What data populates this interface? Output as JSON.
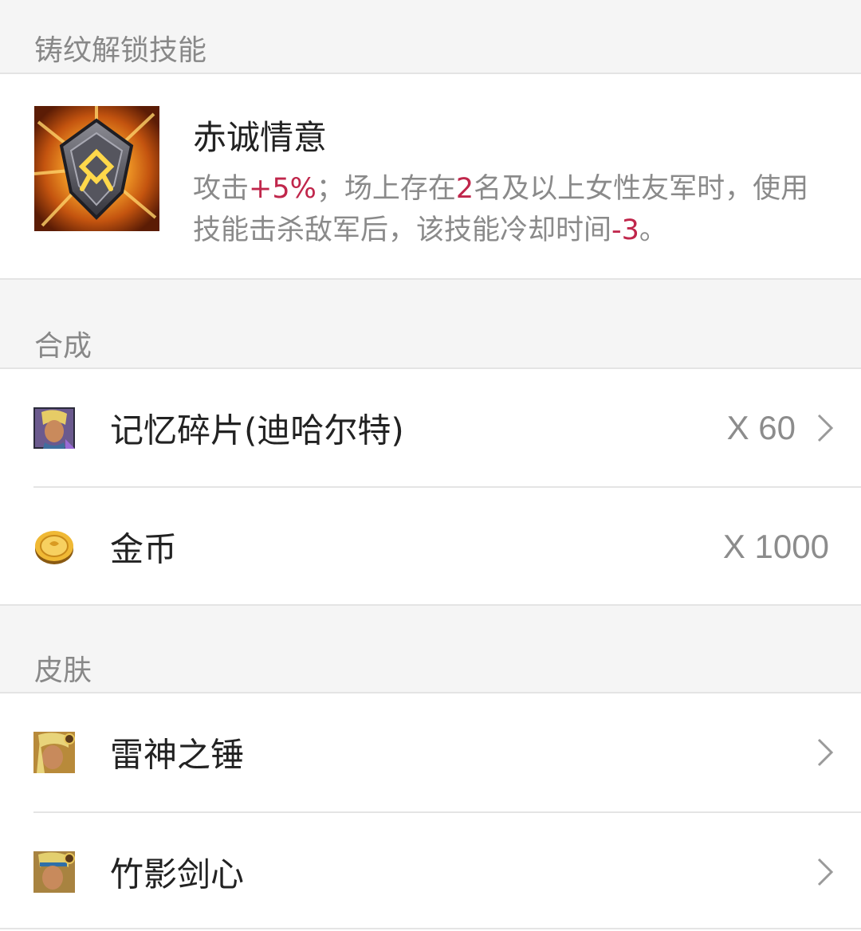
{
  "inscription_section": {
    "title": "铸纹解锁技能",
    "skill": {
      "icon": "inscription-rune-icon",
      "name": "赤诚情意",
      "desc_parts": [
        {
          "text": "攻击",
          "highlight": false
        },
        {
          "text": "+5%",
          "highlight": true
        },
        {
          "text": "；场上存在",
          "highlight": false
        },
        {
          "text": "2",
          "highlight": true
        },
        {
          "text": "名及以上女性友军时，使用技能击杀敌军后，该技能冷却时间",
          "highlight": false
        },
        {
          "text": "-3",
          "highlight": true
        },
        {
          "text": "。",
          "highlight": false
        }
      ]
    }
  },
  "synthesis_section": {
    "title": "合成",
    "items": [
      {
        "icon": "character-portrait-icon",
        "name": "记忆碎片(迪哈尔特)",
        "quantity": "X 60",
        "has_arrow": true
      },
      {
        "icon": "gold-coin-icon",
        "name": "金币",
        "quantity": "X 1000",
        "has_arrow": false
      }
    ]
  },
  "skin_section": {
    "title": "皮肤",
    "items": [
      {
        "icon": "skin-portrait-icon",
        "name": "雷神之锤",
        "has_arrow": true
      },
      {
        "icon": "skin-portrait-icon",
        "name": "竹影剑心",
        "has_arrow": true
      }
    ]
  },
  "colors": {
    "highlight": "#c0264b",
    "secondary_text": "#8a8a8a",
    "section_bg": "#f5f5f5",
    "divider": "#e4e4e4"
  }
}
